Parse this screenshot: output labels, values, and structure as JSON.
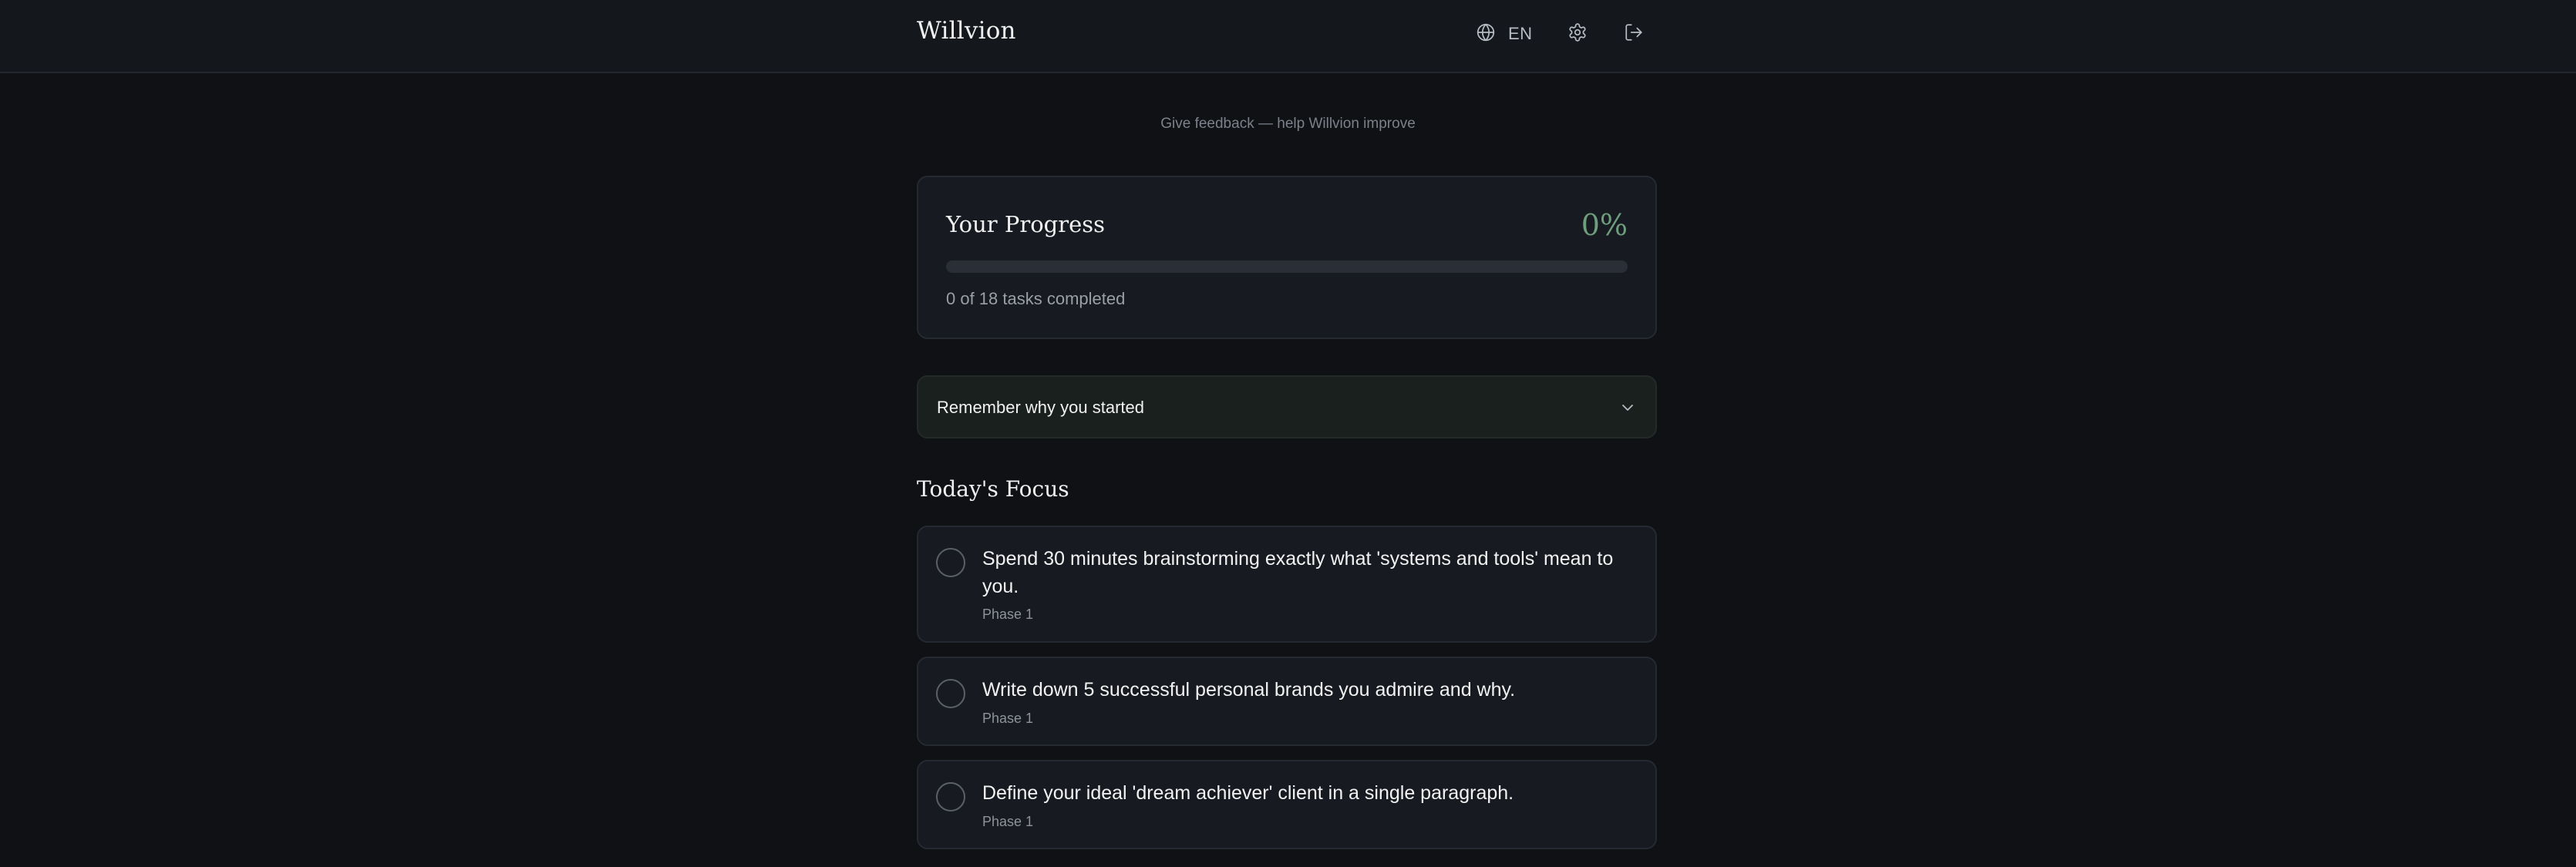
{
  "header": {
    "brand": "Willvion",
    "language_label": "EN",
    "icons": {
      "language": "globe-icon",
      "settings": "gear-icon",
      "logout": "logout-icon"
    }
  },
  "feedback_link": "Give feedback — help Willvion improve",
  "progress": {
    "title": "Your Progress",
    "percent_label": "0%",
    "percent_value": 0,
    "completed_text": "0 of 18 tasks completed"
  },
  "why_section": {
    "label": "Remember why you started",
    "icon": "chevron-down-icon"
  },
  "focus": {
    "title": "Today's Focus",
    "tasks": [
      {
        "title": "Spend 30 minutes brainstorming exactly what 'systems and tools' mean to you.",
        "phase": "Phase 1",
        "completed": false
      },
      {
        "title": "Write down 5 successful personal brands you admire and why.",
        "phase": "Phase 1",
        "completed": false
      },
      {
        "title": "Define your ideal 'dream achiever' client in a single paragraph.",
        "phase": "Phase 1",
        "completed": false
      }
    ]
  },
  "colors": {
    "background": "#0f1115",
    "card": "#171a20",
    "accent": "#6e9e7e",
    "why_card": "#19201d"
  }
}
